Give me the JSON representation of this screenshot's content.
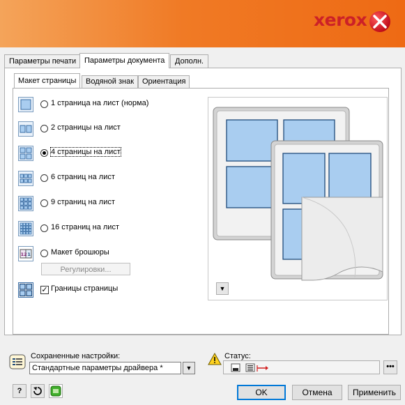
{
  "brand": {
    "logo_text": "xerox"
  },
  "tabs": [
    {
      "label": "Параметры печати"
    },
    {
      "label": "Параметры документа"
    },
    {
      "label": "Дополн."
    }
  ],
  "subtabs": [
    {
      "label": "Макет страницы"
    },
    {
      "label": "Водяной знак"
    },
    {
      "label": "Ориентация"
    }
  ],
  "layout_options": [
    {
      "label": "1 страница на лист (норма)",
      "selected": false
    },
    {
      "label": "2 страницы на лист",
      "selected": false
    },
    {
      "label": "4 страницы на лист",
      "selected": true
    },
    {
      "label": "6 страниц на лист",
      "selected": false
    },
    {
      "label": "9 страниц на лист",
      "selected": false
    },
    {
      "label": "16 страниц на лист",
      "selected": false
    },
    {
      "label": "Макет брошюры",
      "selected": false
    }
  ],
  "adjust_button": {
    "label": "Регулировки..."
  },
  "page_borders": {
    "label": "Границы страницы",
    "checked": true
  },
  "saved_settings": {
    "label": "Сохраненные настройки:",
    "value": "Стандартные параметры драйвера *"
  },
  "status": {
    "label": "Статус:"
  },
  "buttons": {
    "help": "?",
    "ok": "OK",
    "cancel": "Отмена",
    "apply": "Применить"
  },
  "icons": {
    "booklet_left": "12",
    "booklet_right": "1"
  },
  "colors": {
    "banner": "#ee6a14",
    "accent": "#0078d7",
    "page_fill": "#a9cdf0"
  }
}
